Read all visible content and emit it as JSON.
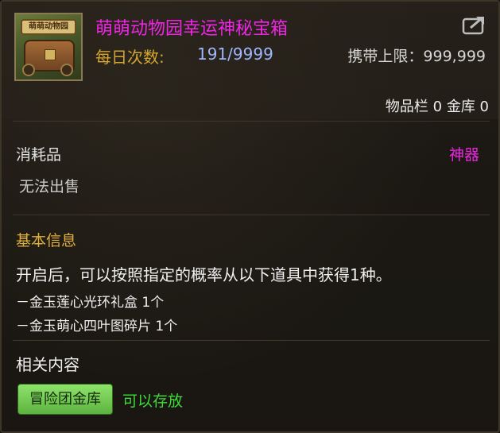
{
  "item": {
    "name": "萌萌动物园幸运神秘宝箱",
    "icon_banner": "萌萌动物园",
    "daily_label": "每日次数:",
    "daily_value": "191/9999",
    "carry_limit": "携带上限：999,999",
    "inventory": "物品栏 0 金库 0"
  },
  "attributes": {
    "category": "消耗品",
    "rarity": "神器",
    "sell_status": "无法出售"
  },
  "basic_info": {
    "title": "基本信息",
    "description": "开启后，可以按照指定的概率从以下道具中获得1种。",
    "rewards": [
      "－金玉莲心光环礼盒 1个",
      "－金玉萌心四叶图碎片 1个"
    ]
  },
  "related": {
    "title": "相关内容",
    "storage_label": "冒险团金库",
    "storage_status": "可以存放"
  },
  "colors": {
    "title_magenta": "#ee26e3",
    "gold": "#d6a62d",
    "value_blue": "#9fb7ff",
    "green_status": "#3edb38",
    "badge_green": "#74cc52"
  },
  "icons": [
    "treasure-chest-item-icon",
    "share-export-icon"
  ]
}
